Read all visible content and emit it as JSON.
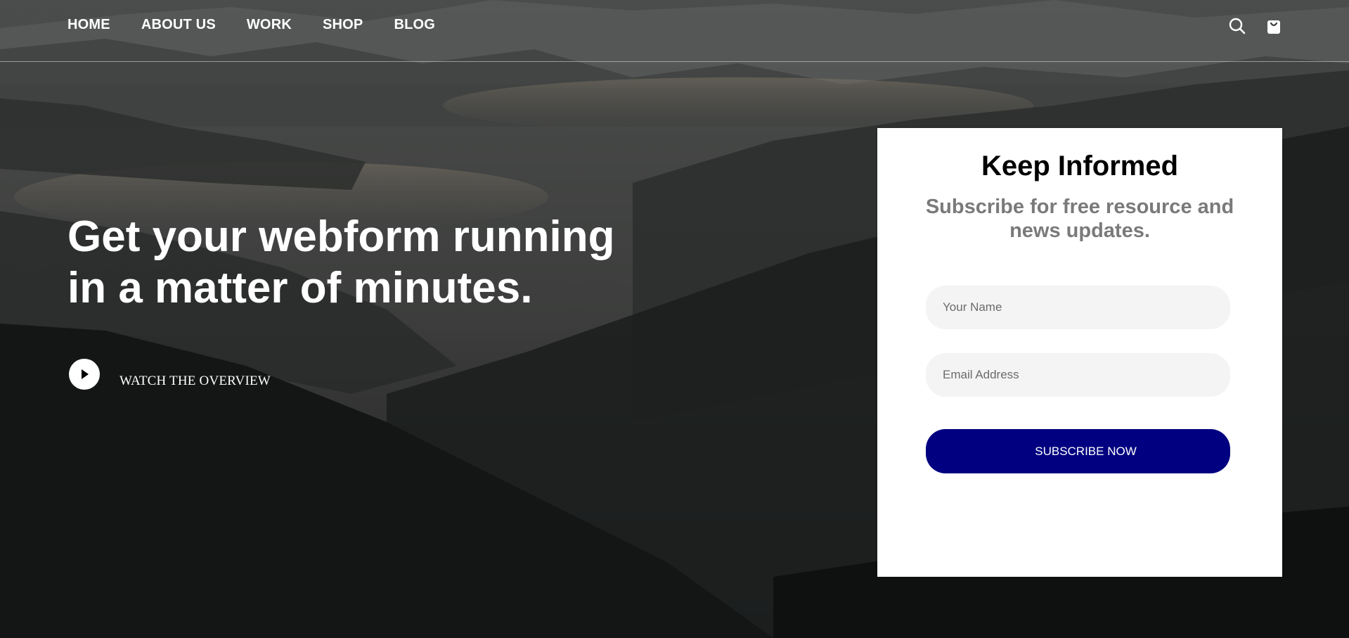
{
  "nav": {
    "items": [
      {
        "label": "HOME"
      },
      {
        "label": "ABOUT US"
      },
      {
        "label": "WORK"
      },
      {
        "label": "SHOP"
      },
      {
        "label": "BLOG"
      }
    ],
    "icons": [
      "search-icon",
      "shopping-bag-icon"
    ]
  },
  "hero": {
    "headline_line1": "Get your webform running",
    "headline_line2": "in a matter of minutes.",
    "watch_label": "WATCH THE OVERVIEW",
    "play_icon": "play-icon"
  },
  "form": {
    "title": "Keep Informed",
    "subtitle": "Subscribe for free resource and news updates.",
    "name_placeholder": "Your Name",
    "email_placeholder": "Email Address",
    "submit_label": "SUBSCRIBE NOW"
  },
  "colors": {
    "button": "#000080",
    "subtitle": "#7a7a7a",
    "field_bg": "#f4f4f4"
  }
}
